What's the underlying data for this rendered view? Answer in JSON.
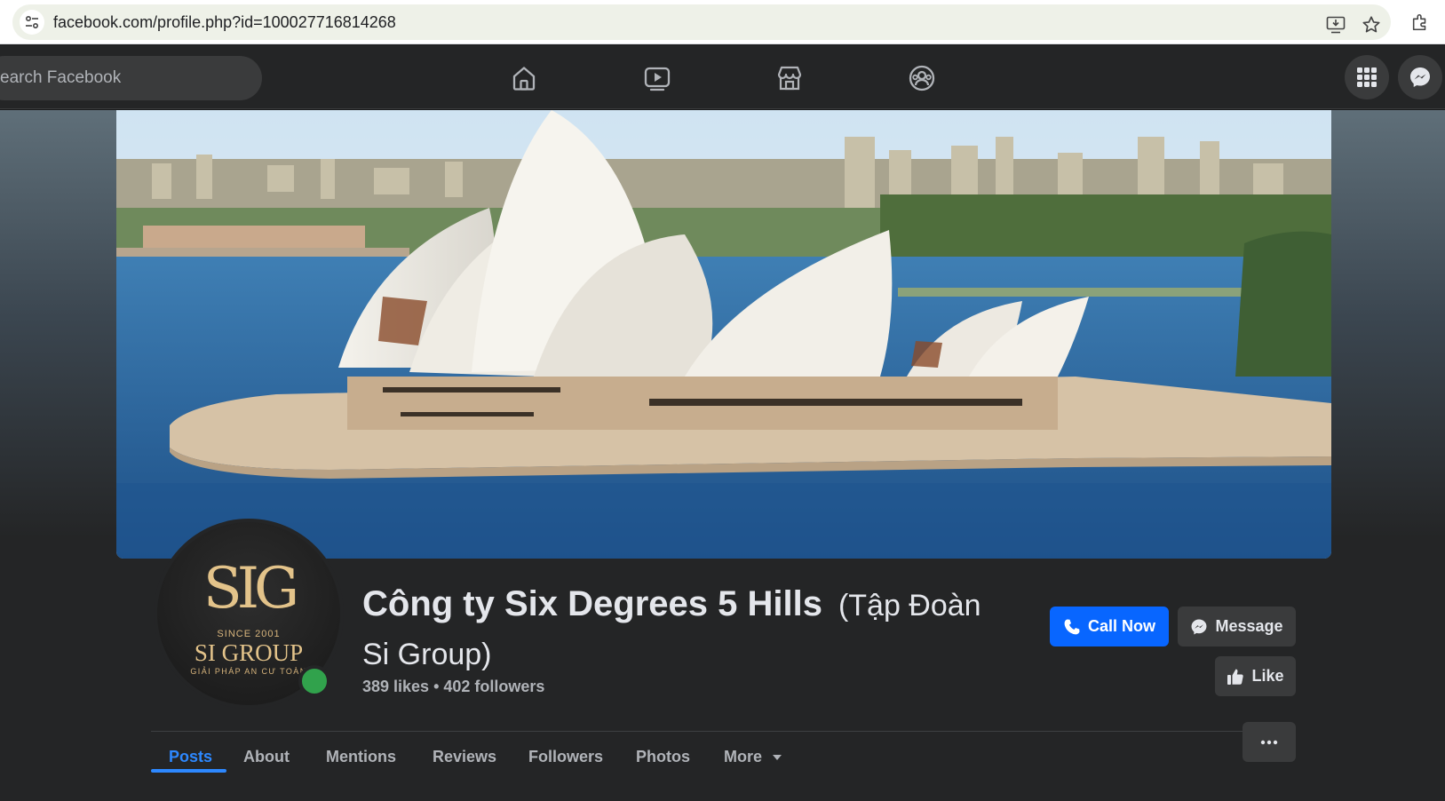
{
  "browser": {
    "url": "facebook.com/profile.php?id=100027716814268"
  },
  "fb_nav": {
    "search_placeholder": "earch Facebook",
    "tabs": [
      {
        "icon": "home-icon"
      },
      {
        "icon": "video-icon"
      },
      {
        "icon": "marketplace-icon"
      },
      {
        "icon": "groups-icon"
      }
    ],
    "right_buttons": [
      {
        "icon": "menu-grid-icon"
      },
      {
        "icon": "messenger-icon"
      }
    ]
  },
  "profile": {
    "logo": {
      "mark": "SIG",
      "since": "SINCE 2001",
      "name": "SI GROUP",
      "tagline": "GIẢI PHÁP AN CƯ TOÀN"
    },
    "name": "Công ty Six Degrees 5 Hills",
    "alternate_name": "(Tập Đoàn Si Group)",
    "stats": "389 likes • 402 followers",
    "online": true
  },
  "actions": {
    "call_now": "Call Now",
    "message": "Message",
    "like": "Like"
  },
  "profile_tabs": [
    {
      "label": "Posts",
      "active": true
    },
    {
      "label": "About",
      "active": false
    },
    {
      "label": "Mentions",
      "active": false
    },
    {
      "label": "Reviews",
      "active": false
    },
    {
      "label": "Followers",
      "active": false
    },
    {
      "label": "Photos",
      "active": false
    },
    {
      "label": "More",
      "active": false
    }
  ],
  "colors": {
    "accent": "#0866ff",
    "active_tab": "#2d88ff",
    "background": "#242526",
    "online": "#31a24c"
  }
}
